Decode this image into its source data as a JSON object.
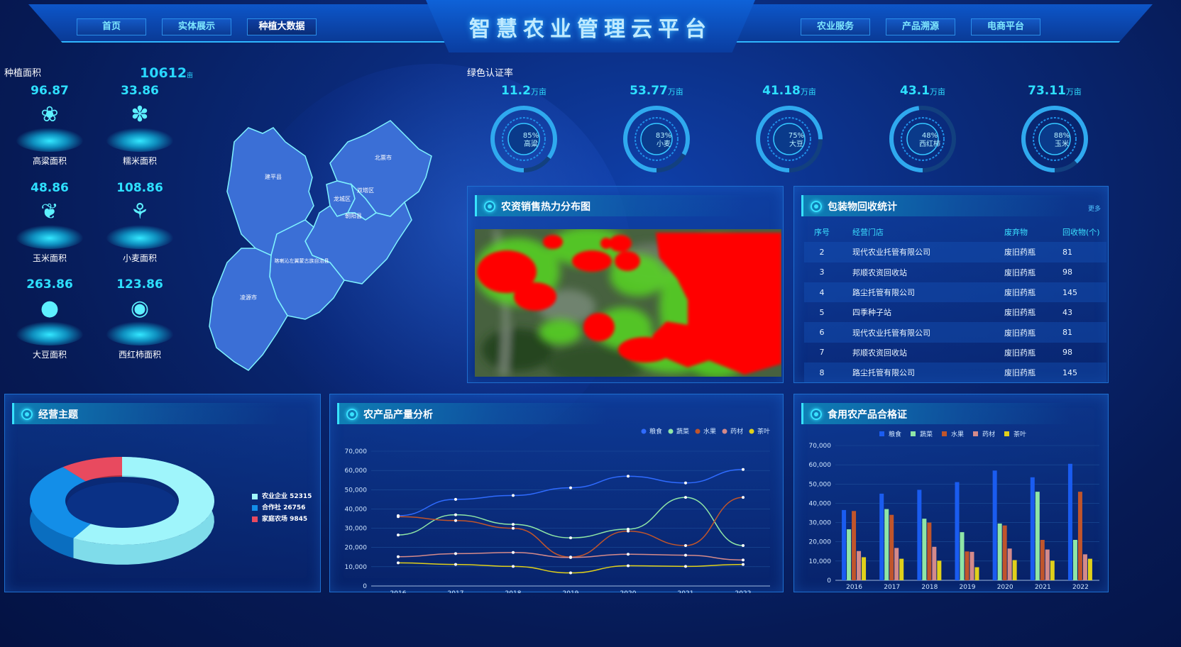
{
  "header": {
    "title": "智慧农业管理云平台",
    "nav_left": [
      "首页",
      "实体展示",
      "种植大数据"
    ],
    "nav_right": [
      "农业服务",
      "产品溯源",
      "电商平台"
    ],
    "active": "种植大数据"
  },
  "planting": {
    "label": "种植面积",
    "total": "10612",
    "total_unit": "亩",
    "crops": [
      {
        "value": "96.87",
        "label": "高粱面积",
        "icon": "sorghum-icon"
      },
      {
        "value": "33.86",
        "label": "糯米面积",
        "icon": "glutinous-rice-icon"
      },
      {
        "value": "48.86",
        "label": "玉米面积",
        "icon": "corn-icon"
      },
      {
        "value": "108.86",
        "label": "小麦面积",
        "icon": "wheat-icon"
      },
      {
        "value": "263.86",
        "label": "大豆面积",
        "icon": "soybean-icon"
      },
      {
        "value": "123.86",
        "label": "西红柿面积",
        "icon": "tomato-icon"
      }
    ]
  },
  "map": {
    "regions": [
      "建平县",
      "北票市",
      "龙城区",
      "双塔区",
      "朝阳县",
      "喀喇沁左翼蒙古族自治县",
      "凌源市"
    ]
  },
  "green": {
    "label": "绿色认证率",
    "gauges": [
      {
        "value": "11.2",
        "unit": "万亩",
        "pct": "85%",
        "name": "高粱",
        "ratio": 0.85
      },
      {
        "value": "53.77",
        "unit": "万亩",
        "pct": "83%",
        "name": "小麦",
        "ratio": 0.83
      },
      {
        "value": "41.18",
        "unit": "万亩",
        "pct": "75%",
        "name": "大豆",
        "ratio": 0.75
      },
      {
        "value": "43.1",
        "unit": "万亩",
        "pct": "48%",
        "name": "西红柿",
        "ratio": 0.48
      },
      {
        "value": "73.11",
        "unit": "万亩",
        "pct": "88%",
        "name": "玉米",
        "ratio": 0.88
      }
    ]
  },
  "heatmap": {
    "title": "农资销售热力分布图"
  },
  "recycle": {
    "title": "包装物回收统计",
    "more": "更多",
    "headers": [
      "序号",
      "经营门店",
      "废弃物",
      "回收物(个)"
    ],
    "rows": [
      [
        "2",
        "现代农业托管有限公司",
        "废旧药瓶",
        "81"
      ],
      [
        "3",
        "邦顺农资回收站",
        "废旧药瓶",
        "98"
      ],
      [
        "4",
        "路尘托管有限公司",
        "废旧药瓶",
        "145"
      ],
      [
        "5",
        "四季种子站",
        "废旧药瓶",
        "43"
      ],
      [
        "6",
        "现代农业托管有限公司",
        "废旧药瓶",
        "81"
      ],
      [
        "7",
        "邦顺农资回收站",
        "废旧药瓶",
        "98"
      ],
      [
        "8",
        "路尘托管有限公司",
        "废旧药瓶",
        "145"
      ]
    ]
  },
  "business": {
    "title": "经营主题",
    "legend": [
      "农业企业 52315",
      "合作社 26756",
      "家庭农场 9845"
    ]
  },
  "output": {
    "title": "农产品产量分析"
  },
  "quality": {
    "title": "食用农产品合格证"
  },
  "chart_data": [
    {
      "type": "pie",
      "title": "经营主题",
      "labels": [
        "农业企业",
        "合作社",
        "家庭农场"
      ],
      "values": [
        52315,
        26756,
        9845
      ],
      "colors": [
        "#9ff5fb",
        "#138ee8",
        "#e84a5f"
      ]
    },
    {
      "type": "line",
      "title": "农产品产量分析",
      "x": [
        "2016",
        "2017",
        "2018",
        "2019",
        "2020",
        "2021",
        "2022"
      ],
      "ylim": [
        0,
        70000
      ],
      "yticks": [
        0,
        10000,
        20000,
        30000,
        40000,
        50000,
        60000,
        70000
      ],
      "legend_position": "top-right",
      "series": [
        {
          "name": "粮食",
          "color": "#2f6bff",
          "values": [
            36500,
            45000,
            47000,
            51000,
            57000,
            53500,
            60500
          ]
        },
        {
          "name": "蔬菜",
          "color": "#8fe6a6",
          "values": [
            26500,
            37000,
            32000,
            25000,
            29500,
            46000,
            21000
          ]
        },
        {
          "name": "水果",
          "color": "#c0552b",
          "values": [
            36000,
            34000,
            30000,
            15000,
            28500,
            21000,
            46000
          ]
        },
        {
          "name": "药材",
          "color": "#d48a8a",
          "values": [
            15200,
            16800,
            17400,
            14800,
            16500,
            16000,
            13500
          ]
        },
        {
          "name": "茶叶",
          "color": "#e0d01a",
          "values": [
            12000,
            11200,
            10200,
            6800,
            10500,
            10200,
            11200
          ]
        }
      ]
    },
    {
      "type": "bar",
      "title": "食用农产品合格证",
      "categories": [
        "2016",
        "2017",
        "2018",
        "2019",
        "2020",
        "2021",
        "2022"
      ],
      "ylim": [
        0,
        70000
      ],
      "yticks": [
        0,
        10000,
        20000,
        30000,
        40000,
        50000,
        60000,
        70000
      ],
      "legend_position": "top-center",
      "series": [
        {
          "name": "粮食",
          "color": "#1a5cf0",
          "values": [
            36500,
            45000,
            47000,
            51000,
            57000,
            53500,
            60500
          ]
        },
        {
          "name": "蔬菜",
          "color": "#8fe6a6",
          "values": [
            26500,
            37000,
            32000,
            25000,
            29500,
            46000,
            21000
          ]
        },
        {
          "name": "水果",
          "color": "#c0552b",
          "values": [
            36000,
            34000,
            30000,
            15000,
            28500,
            21000,
            46000
          ]
        },
        {
          "name": "药材",
          "color": "#d48a8a",
          "values": [
            15200,
            16800,
            17400,
            14800,
            16500,
            16000,
            13500
          ]
        },
        {
          "name": "茶叶",
          "color": "#e0d01a",
          "values": [
            12000,
            11200,
            10200,
            6800,
            10500,
            10200,
            11200
          ]
        }
      ]
    }
  ]
}
